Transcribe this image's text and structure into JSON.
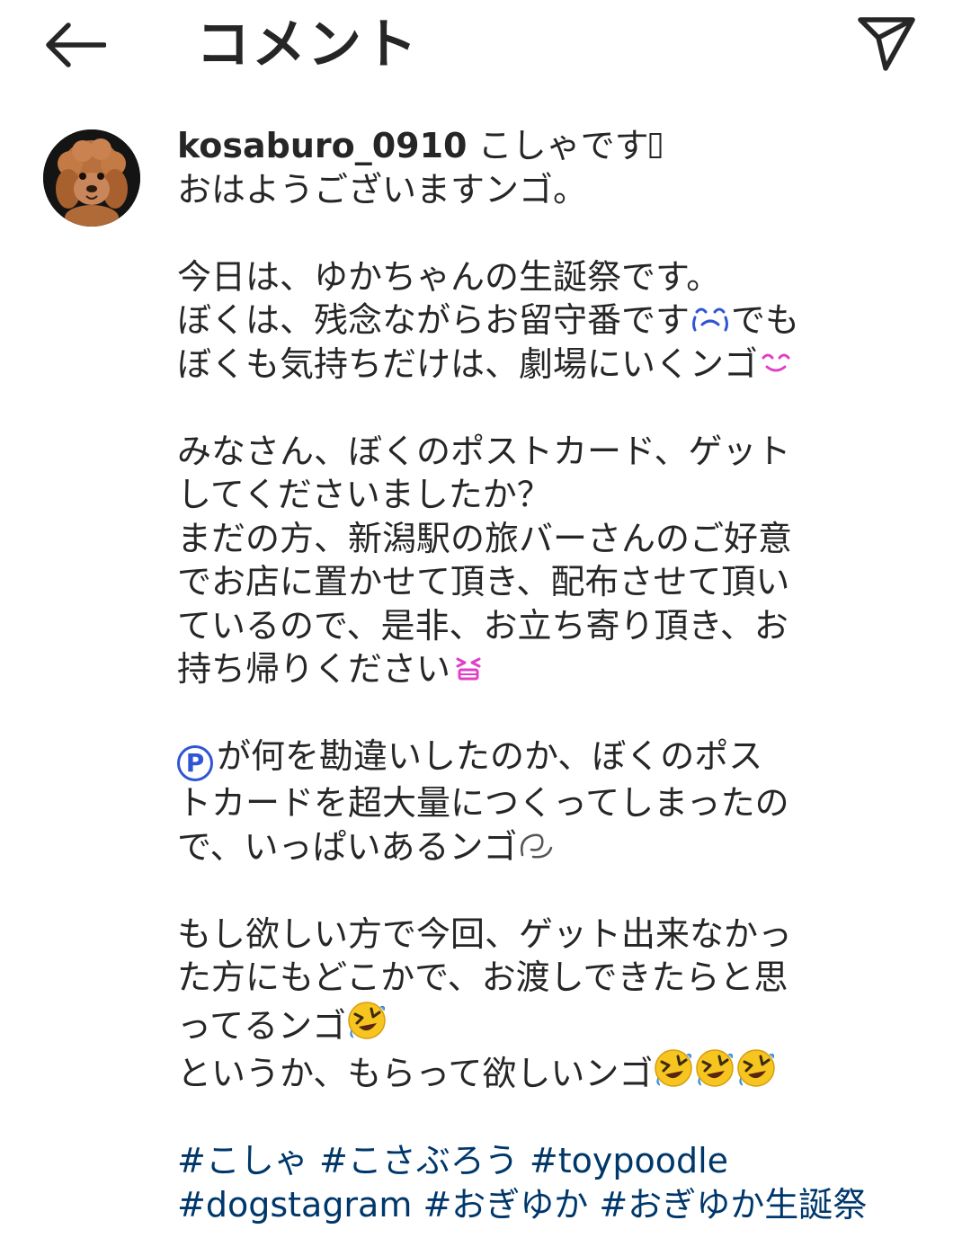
{
  "header": {
    "title": "コメント",
    "back_icon": "arrow-left-icon",
    "share_icon": "paper-plane-icon"
  },
  "comment": {
    "username": "kosaburo_0910",
    "first_line_text": " こしゃです",
    "paragraphs": [
      [
        "おはようございますンゴ。"
      ],
      [
        "今日は、ゆかちゃんの生誕祭です。",
        "ぼくは、残念ながらお留守番です",
        "でも",
        "ぼくも気持ちだけは、劇場にいくンゴ"
      ],
      [
        "みなさん、ぼくのポストカード、ゲット",
        "してくださいましたか？",
        "まだの方、新潟駅の旅バーさんのご好意",
        "でお店に置かせて頂き、配布させて頂い",
        "ているので、是非、お立ち寄り頂き、お",
        "持ち帰りください"
      ],
      [
        "が何を勘違いしたのか、ぼくのポス",
        "トカードを超大量につくってしまったの",
        "で、いっぱいあるンゴ"
      ],
      [
        "もし欲しい方で今回、ゲット出来なかっ",
        "た方にもどこかで、お渡しできたらと思",
        "ってるンゴ",
        "というか、もらって欲しいンゴ"
      ]
    ],
    "p_badge": "P",
    "hashtags_line1": [
      "#こしゃ",
      "#こさぶろう",
      "#toypoodle"
    ],
    "hashtags_line2": [
      "#dogstagram",
      "#おぎゆか",
      "#おぎゆか生誕祭"
    ]
  },
  "colors": {
    "text": "#262626",
    "hashtag": "#00376b",
    "badge": "#2f55d4",
    "emoji_pink": "#e040c8",
    "emoji_blue": "#2f55d4"
  }
}
